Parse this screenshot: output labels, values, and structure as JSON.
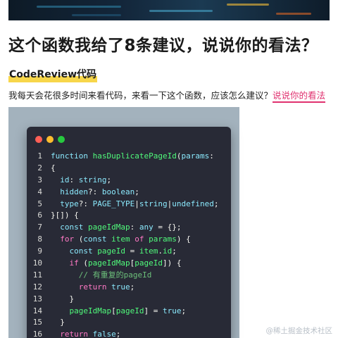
{
  "article": {
    "title": "这个函数我给了8条建议，说说你的看法？",
    "tag": "CodeReview代码",
    "intro": "我每天会花很多时间来看代码，来看一下这个函数，应该怎么建议？",
    "intro_link": "说说你的看法"
  },
  "colors": {
    "tag_highlight": "#f7d64a",
    "link": "#e0316f",
    "code_bg": "#282a36",
    "frame_bg": "#a3b2bd",
    "dot_close": "#ff5f56",
    "dot_minimize": "#ffbd2e",
    "dot_maximize": "#27c93f"
  },
  "code": {
    "lines": [
      {
        "n": "1",
        "tokens": [
          [
            "function ",
            "#8be9fd"
          ],
          [
            "hasDuplicatePageId",
            "#50fa7b"
          ],
          [
            "(",
            "#f8f8f2"
          ],
          [
            "params",
            "#8be9fd"
          ],
          [
            ":",
            "#f8f8f2"
          ]
        ]
      },
      {
        "n": "2",
        "tokens": [
          [
            "{",
            "#f8f8f2"
          ]
        ]
      },
      {
        "n": "3",
        "tokens": [
          [
            "  id",
            "#8be9fd"
          ],
          [
            ": ",
            "#f8f8f2"
          ],
          [
            "string",
            "#8be9fd"
          ],
          [
            ";",
            "#f8f8f2"
          ]
        ]
      },
      {
        "n": "4",
        "tokens": [
          [
            "  hidden",
            "#8be9fd"
          ],
          [
            "?: ",
            "#f8f8f2"
          ],
          [
            "boolean",
            "#8be9fd"
          ],
          [
            ";",
            "#f8f8f2"
          ]
        ]
      },
      {
        "n": "5",
        "tokens": [
          [
            "  type",
            "#8be9fd"
          ],
          [
            "?: ",
            "#f8f8f2"
          ],
          [
            "PAGE_TYPE",
            "#8be9fd"
          ],
          [
            "|",
            "#f8f8f2"
          ],
          [
            "string",
            "#8be9fd"
          ],
          [
            "|",
            "#f8f8f2"
          ],
          [
            "undefined",
            "#8be9fd"
          ],
          [
            ";",
            "#f8f8f2"
          ]
        ]
      },
      {
        "n": "6",
        "tokens": [
          [
            "}[]) {",
            "#f8f8f2"
          ]
        ]
      },
      {
        "n": "7",
        "tokens": [
          [
            "  const ",
            "#8be9fd"
          ],
          [
            "pageIdMap",
            "#50fa7b"
          ],
          [
            ": ",
            "#f8f8f2"
          ],
          [
            "any",
            "#8be9fd"
          ],
          [
            " = {};",
            "#f8f8f2"
          ]
        ]
      },
      {
        "n": "8",
        "tokens": [
          [
            "  for ",
            "#ff79c6"
          ],
          [
            "(",
            "#f8f8f2"
          ],
          [
            "const ",
            "#8be9fd"
          ],
          [
            "item ",
            "#50fa7b"
          ],
          [
            "of ",
            "#ff79c6"
          ],
          [
            "params",
            "#50fa7b"
          ],
          [
            ") {",
            "#f8f8f2"
          ]
        ]
      },
      {
        "n": "9",
        "tokens": [
          [
            "    const ",
            "#8be9fd"
          ],
          [
            "pageId",
            "#50fa7b"
          ],
          [
            " = ",
            "#f8f8f2"
          ],
          [
            "item",
            "#50fa7b"
          ],
          [
            ".",
            "#f8f8f2"
          ],
          [
            "id",
            "#50fa7b"
          ],
          [
            ";",
            "#f8f8f2"
          ]
        ]
      },
      {
        "n": "10",
        "tokens": [
          [
            "    if ",
            "#ff79c6"
          ],
          [
            "(",
            "#f8f8f2"
          ],
          [
            "pageIdMap",
            "#50fa7b"
          ],
          [
            "[",
            "#f8f8f2"
          ],
          [
            "pageId",
            "#50fa7b"
          ],
          [
            "]) {",
            "#f8f8f2"
          ]
        ]
      },
      {
        "n": "11",
        "tokens": [
          [
            "      // 有重复的pageId",
            "#6cbf7a"
          ]
        ]
      },
      {
        "n": "12",
        "tokens": [
          [
            "      return ",
            "#ff79c6"
          ],
          [
            "true",
            "#8be9fd"
          ],
          [
            ";",
            "#f8f8f2"
          ]
        ]
      },
      {
        "n": "13",
        "tokens": [
          [
            "    }",
            "#f8f8f2"
          ]
        ]
      },
      {
        "n": "14",
        "tokens": [
          [
            "    pageIdMap",
            "#50fa7b"
          ],
          [
            "[",
            "#f8f8f2"
          ],
          [
            "pageId",
            "#50fa7b"
          ],
          [
            "] = ",
            "#f8f8f2"
          ],
          [
            "true",
            "#8be9fd"
          ],
          [
            ";",
            "#f8f8f2"
          ]
        ]
      },
      {
        "n": "15",
        "tokens": [
          [
            "  }",
            "#f8f8f2"
          ]
        ]
      },
      {
        "n": "16",
        "tokens": [
          [
            "  return ",
            "#ff79c6"
          ],
          [
            "false",
            "#8be9fd"
          ],
          [
            ";",
            "#f8f8f2"
          ]
        ]
      }
    ]
  },
  "watermark": "@稀土掘金技术社区"
}
